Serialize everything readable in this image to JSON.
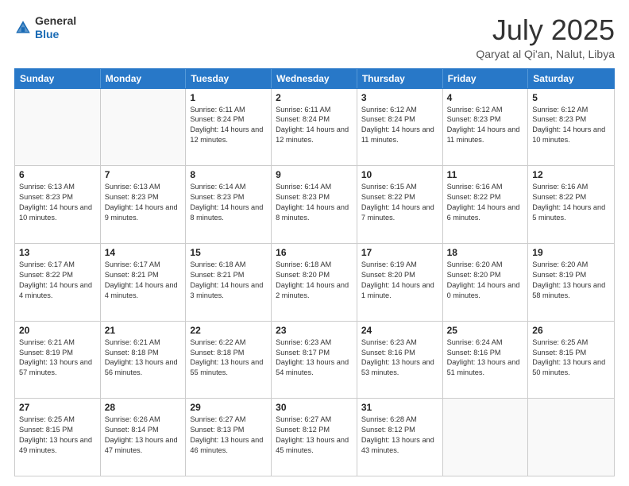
{
  "header": {
    "logo_general": "General",
    "logo_blue": "Blue",
    "title": "July 2025",
    "subtitle": "Qaryat al Qi'an, Nalut, Libya"
  },
  "days": [
    "Sunday",
    "Monday",
    "Tuesday",
    "Wednesday",
    "Thursday",
    "Friday",
    "Saturday"
  ],
  "weeks": [
    [
      {
        "day": "",
        "text": ""
      },
      {
        "day": "",
        "text": ""
      },
      {
        "day": "1",
        "text": "Sunrise: 6:11 AM\nSunset: 8:24 PM\nDaylight: 14 hours and 12 minutes."
      },
      {
        "day": "2",
        "text": "Sunrise: 6:11 AM\nSunset: 8:24 PM\nDaylight: 14 hours and 12 minutes."
      },
      {
        "day": "3",
        "text": "Sunrise: 6:12 AM\nSunset: 8:24 PM\nDaylight: 14 hours and 11 minutes."
      },
      {
        "day": "4",
        "text": "Sunrise: 6:12 AM\nSunset: 8:23 PM\nDaylight: 14 hours and 11 minutes."
      },
      {
        "day": "5",
        "text": "Sunrise: 6:12 AM\nSunset: 8:23 PM\nDaylight: 14 hours and 10 minutes."
      }
    ],
    [
      {
        "day": "6",
        "text": "Sunrise: 6:13 AM\nSunset: 8:23 PM\nDaylight: 14 hours and 10 minutes."
      },
      {
        "day": "7",
        "text": "Sunrise: 6:13 AM\nSunset: 8:23 PM\nDaylight: 14 hours and 9 minutes."
      },
      {
        "day": "8",
        "text": "Sunrise: 6:14 AM\nSunset: 8:23 PM\nDaylight: 14 hours and 8 minutes."
      },
      {
        "day": "9",
        "text": "Sunrise: 6:14 AM\nSunset: 8:23 PM\nDaylight: 14 hours and 8 minutes."
      },
      {
        "day": "10",
        "text": "Sunrise: 6:15 AM\nSunset: 8:22 PM\nDaylight: 14 hours and 7 minutes."
      },
      {
        "day": "11",
        "text": "Sunrise: 6:16 AM\nSunset: 8:22 PM\nDaylight: 14 hours and 6 minutes."
      },
      {
        "day": "12",
        "text": "Sunrise: 6:16 AM\nSunset: 8:22 PM\nDaylight: 14 hours and 5 minutes."
      }
    ],
    [
      {
        "day": "13",
        "text": "Sunrise: 6:17 AM\nSunset: 8:22 PM\nDaylight: 14 hours and 4 minutes."
      },
      {
        "day": "14",
        "text": "Sunrise: 6:17 AM\nSunset: 8:21 PM\nDaylight: 14 hours and 4 minutes."
      },
      {
        "day": "15",
        "text": "Sunrise: 6:18 AM\nSunset: 8:21 PM\nDaylight: 14 hours and 3 minutes."
      },
      {
        "day": "16",
        "text": "Sunrise: 6:18 AM\nSunset: 8:20 PM\nDaylight: 14 hours and 2 minutes."
      },
      {
        "day": "17",
        "text": "Sunrise: 6:19 AM\nSunset: 8:20 PM\nDaylight: 14 hours and 1 minute."
      },
      {
        "day": "18",
        "text": "Sunrise: 6:20 AM\nSunset: 8:20 PM\nDaylight: 14 hours and 0 minutes."
      },
      {
        "day": "19",
        "text": "Sunrise: 6:20 AM\nSunset: 8:19 PM\nDaylight: 13 hours and 58 minutes."
      }
    ],
    [
      {
        "day": "20",
        "text": "Sunrise: 6:21 AM\nSunset: 8:19 PM\nDaylight: 13 hours and 57 minutes."
      },
      {
        "day": "21",
        "text": "Sunrise: 6:21 AM\nSunset: 8:18 PM\nDaylight: 13 hours and 56 minutes."
      },
      {
        "day": "22",
        "text": "Sunrise: 6:22 AM\nSunset: 8:18 PM\nDaylight: 13 hours and 55 minutes."
      },
      {
        "day": "23",
        "text": "Sunrise: 6:23 AM\nSunset: 8:17 PM\nDaylight: 13 hours and 54 minutes."
      },
      {
        "day": "24",
        "text": "Sunrise: 6:23 AM\nSunset: 8:16 PM\nDaylight: 13 hours and 53 minutes."
      },
      {
        "day": "25",
        "text": "Sunrise: 6:24 AM\nSunset: 8:16 PM\nDaylight: 13 hours and 51 minutes."
      },
      {
        "day": "26",
        "text": "Sunrise: 6:25 AM\nSunset: 8:15 PM\nDaylight: 13 hours and 50 minutes."
      }
    ],
    [
      {
        "day": "27",
        "text": "Sunrise: 6:25 AM\nSunset: 8:15 PM\nDaylight: 13 hours and 49 minutes."
      },
      {
        "day": "28",
        "text": "Sunrise: 6:26 AM\nSunset: 8:14 PM\nDaylight: 13 hours and 47 minutes."
      },
      {
        "day": "29",
        "text": "Sunrise: 6:27 AM\nSunset: 8:13 PM\nDaylight: 13 hours and 46 minutes."
      },
      {
        "day": "30",
        "text": "Sunrise: 6:27 AM\nSunset: 8:12 PM\nDaylight: 13 hours and 45 minutes."
      },
      {
        "day": "31",
        "text": "Sunrise: 6:28 AM\nSunset: 8:12 PM\nDaylight: 13 hours and 43 minutes."
      },
      {
        "day": "",
        "text": ""
      },
      {
        "day": "",
        "text": ""
      }
    ]
  ]
}
